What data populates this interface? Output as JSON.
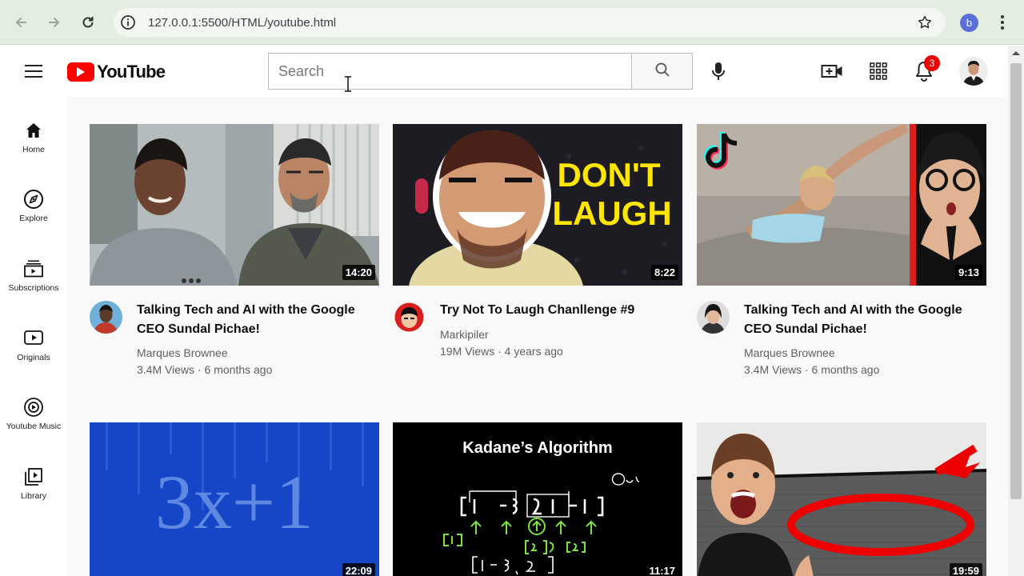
{
  "browser": {
    "url": "127.0.0.1:5500/HTML/youtube.html",
    "profile_initial": "b",
    "icons": [
      "back-icon",
      "forward-icon",
      "reload-icon",
      "info-icon",
      "star-icon",
      "menu-dots-icon"
    ]
  },
  "header": {
    "logo_text": "YouTube",
    "search_placeholder": "Search",
    "notification_count": "3",
    "accent": "#ff0000"
  },
  "sidebar": {
    "items": [
      {
        "label": "Home",
        "icon": "home-icon"
      },
      {
        "label": "Explore",
        "icon": "compass-icon"
      },
      {
        "label": "Subscriptions",
        "icon": "subscriptions-icon"
      },
      {
        "label": "Originals",
        "icon": "originals-icon"
      },
      {
        "label": "Youtube Music",
        "icon": "music-icon"
      },
      {
        "label": "Library",
        "icon": "library-icon"
      }
    ]
  },
  "videos": [
    {
      "title": "Talking Tech and AI with the Google CEO Sundal Pichae!",
      "channel": "Marques Brownee",
      "meta": "3.4M Views · 6 months ago",
      "duration": "14:20"
    },
    {
      "title": "Try Not To Laugh Chanllenge #9",
      "channel": "Markipiler",
      "meta": "19M Views · 4 years ago",
      "duration": "8:22",
      "thumb_text": [
        "DON'T",
        "LAUGH"
      ]
    },
    {
      "title": "Talking Tech and AI with the Google CEO Sundal Pichae!",
      "channel": "Marques Brownee",
      "meta": "3.4M Views · 6 months ago",
      "duration": "9:13"
    },
    {
      "duration": "22:09",
      "thumb_text": "3x+1"
    },
    {
      "duration": "11:17",
      "thumb_text": "Kadane’s Algorithm"
    },
    {
      "duration": "19:59"
    }
  ]
}
